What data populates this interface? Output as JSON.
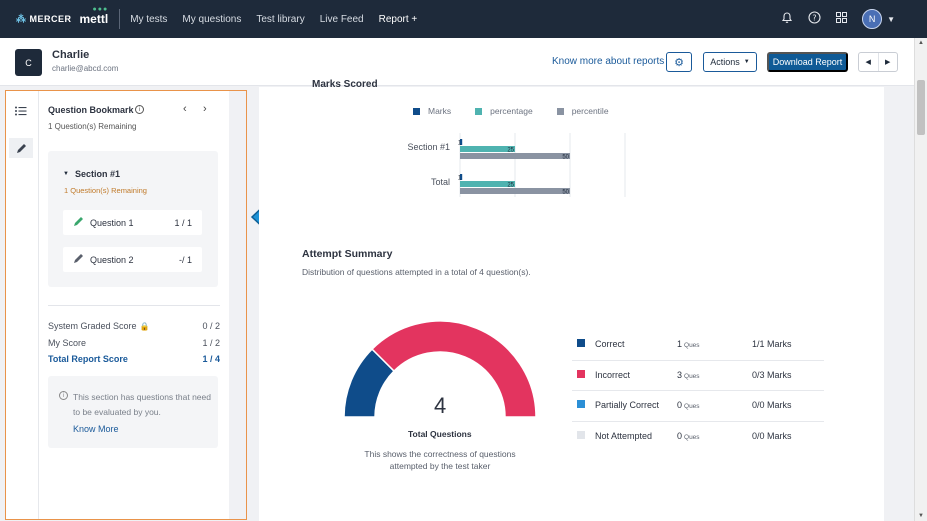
{
  "nav": {
    "brand_mercer": "MERCER",
    "brand_mettl": "mettl",
    "links": [
      "My tests",
      "My questions",
      "Test library",
      "Live Feed",
      "Report +"
    ],
    "avatar_initial": "N"
  },
  "header": {
    "avatar_initial": "C",
    "name": "Charlie",
    "email": "charlie@abcd.com",
    "know_more": "Know more about reports",
    "actions_label": "Actions",
    "download_label": "Download Report"
  },
  "bookmark": {
    "title": "Question Bookmark",
    "remaining": "1 Question(s) Remaining",
    "section": {
      "title": "Section #1",
      "remaining": "1 Question(s) Remaining",
      "questions": [
        {
          "name": "Question 1",
          "score": "1 / 1",
          "pen_color": "#3aa76d"
        },
        {
          "name": "Question 2",
          "score": "-/ 1",
          "pen_color": "#5a606c"
        }
      ]
    },
    "scores": {
      "system_label": "System Graded Score",
      "system_value": "0 / 2",
      "my_label": "My Score",
      "my_value": "1 / 2",
      "total_label": "Total Report Score",
      "total_value": "1 / 4"
    },
    "note": {
      "text": "This section has questions that need to be evaluated by you.",
      "link": "Know More"
    }
  },
  "chart_data": {
    "type": "bar",
    "title": "Marks Scored",
    "orientation": "horizontal",
    "categories": [
      "Section #1",
      "Total"
    ],
    "series": [
      {
        "name": "Marks",
        "color": "#0f4c8a",
        "values": [
          1,
          1
        ]
      },
      {
        "name": "percentage",
        "color": "#4fb3b0",
        "values": [
          25,
          25
        ]
      },
      {
        "name": "percentile",
        "color": "#8a93a2",
        "values": [
          50,
          50
        ]
      }
    ],
    "data_labels": [
      [
        "1",
        "25",
        "50"
      ],
      [
        "1",
        "25",
        "50"
      ]
    ],
    "xlim": [
      0,
      100
    ],
    "legend": "top",
    "grid": true
  },
  "attempt": {
    "title": "Attempt Summary",
    "subtitle": "Distribution of questions attempted in a total of 4 question(s).",
    "total": "4",
    "total_label": "Total Questions",
    "description": "This shows the correctness of questions attempted by the test taker",
    "unit": "Ques",
    "rows": [
      {
        "name": "Correct",
        "count": 1,
        "count_text": "1",
        "marks": "1/1 Marks",
        "color": "#0f4c8a"
      },
      {
        "name": "Incorrect",
        "count": 3,
        "count_text": "3",
        "marks": "0/3 Marks",
        "color": "#e3345f"
      },
      {
        "name": "Partially Correct",
        "count": 0,
        "count_text": "0",
        "marks": "0/0 Marks",
        "color": "#2b8fd6"
      },
      {
        "name": "Not Attempted",
        "count": 0,
        "count_text": "0",
        "marks": "0/0 Marks",
        "color": "#e2e5ea"
      }
    ]
  }
}
